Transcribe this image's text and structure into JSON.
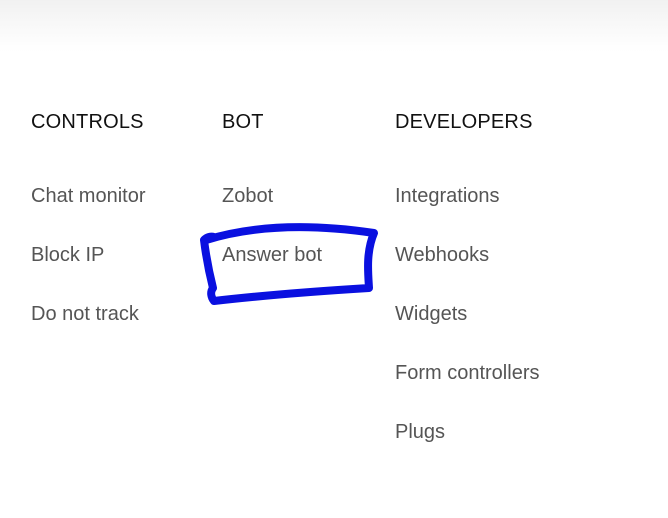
{
  "footer_nav": {
    "columns": [
      {
        "heading": "CONTROLS",
        "items": [
          "Chat monitor",
          "Block IP",
          "Do not track"
        ]
      },
      {
        "heading": "BOT",
        "items": [
          "Zobot",
          "Answer bot"
        ]
      },
      {
        "heading": "DEVELOPERS",
        "items": [
          "Integrations",
          "Webhooks",
          "Widgets",
          "Form controllers",
          "Plugs"
        ]
      }
    ]
  },
  "colors": {
    "heading": "#111111",
    "link": "#555555",
    "annotation": "#0a10e0"
  }
}
